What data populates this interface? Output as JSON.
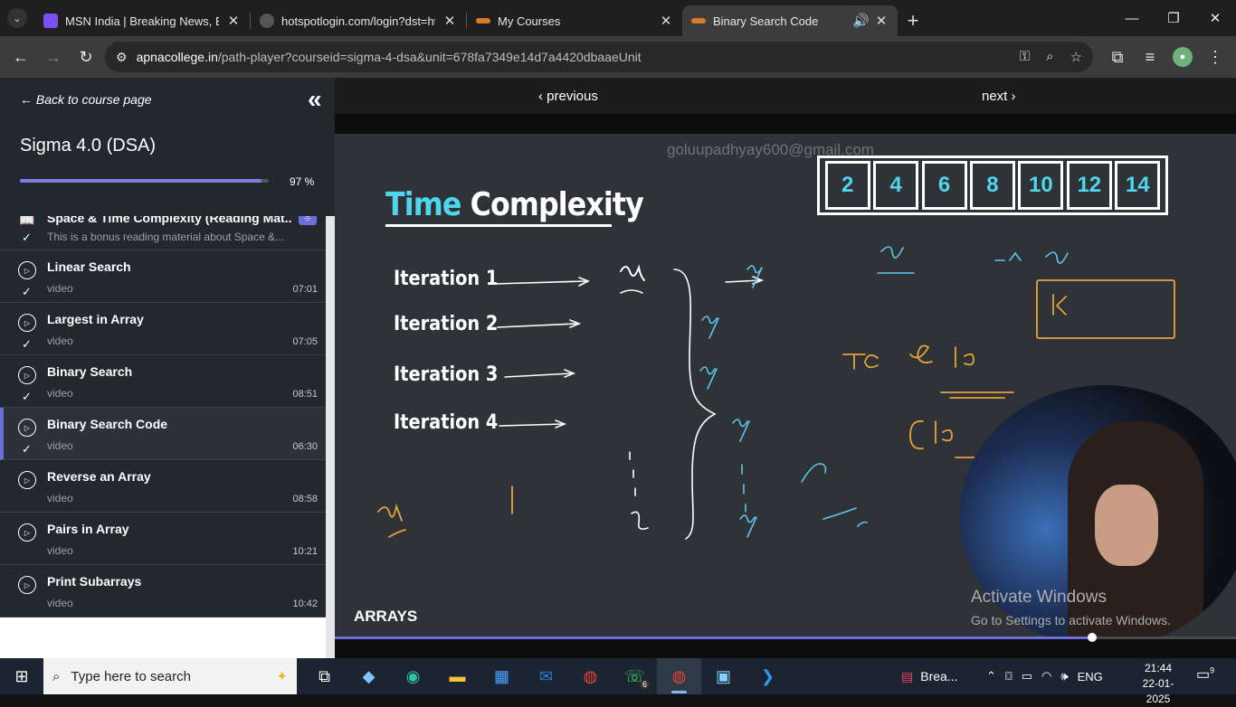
{
  "browser": {
    "tabs": [
      {
        "title": "MSN India | Breaking News, Ent",
        "fav_color": "#7b4ff0"
      },
      {
        "title": "hotspotlogin.com/login?dst=ht",
        "fav_color": "#e0e0e0"
      },
      {
        "title": "My Courses",
        "fav_color": "#d77b2a"
      },
      {
        "title": "Binary Search Code",
        "fav_color": "#d77b2a"
      }
    ],
    "url_host": "apnacollege.in",
    "url_path": "/path-player?courseid=sigma-4-dsa&unit=678fa7349e14d7a4420dbaaeUnit"
  },
  "sidebar": {
    "back_label": "Back to course page",
    "course_title": "Sigma 4.0 (DSA)",
    "progress_pct": "97 %",
    "progress_value": 97,
    "lessons": [
      {
        "title": "Space & Time Complexity (Reading Mat...",
        "type": "This is a bonus reading material about Space &...",
        "duration": ""
      },
      {
        "title": "Linear Search",
        "type": "video",
        "duration": "07:01"
      },
      {
        "title": "Largest in Array",
        "type": "video",
        "duration": "07:05"
      },
      {
        "title": "Binary Search",
        "type": "video",
        "duration": "08:51"
      },
      {
        "title": "Binary Search Code",
        "type": "video",
        "duration": "06:30"
      },
      {
        "title": "Reverse an Array",
        "type": "video",
        "duration": "08:58"
      },
      {
        "title": "Pairs in Array",
        "type": "video",
        "duration": "10:21"
      },
      {
        "title": "Print Subarrays",
        "type": "video",
        "duration": "10:42"
      }
    ]
  },
  "player": {
    "prev_label": "‹ previous",
    "next_label": "next ›",
    "watermark": "goluupadhyay600@gmail.com",
    "slide_title_a": "Time",
    "slide_title_b": "Complexity",
    "array_values": [
      "2",
      "4",
      "6",
      "8",
      "10",
      "12",
      "14"
    ],
    "iterations": [
      "Iteration 1",
      "Iteration 2",
      "Iteration 3",
      "Iteration 4"
    ],
    "section_label": "ARRAYS",
    "activate_title": "Activate Windows",
    "activate_sub": "Go to Settings to activate Windows.",
    "seek_fraction": 0.84
  },
  "taskbar": {
    "search_placeholder": "Type here to search",
    "news_label": "Brea...",
    "lang": "ENG",
    "time": "21:44",
    "date": "22-01-2025",
    "whatsapp_badge": "6",
    "notif_count": "9"
  }
}
